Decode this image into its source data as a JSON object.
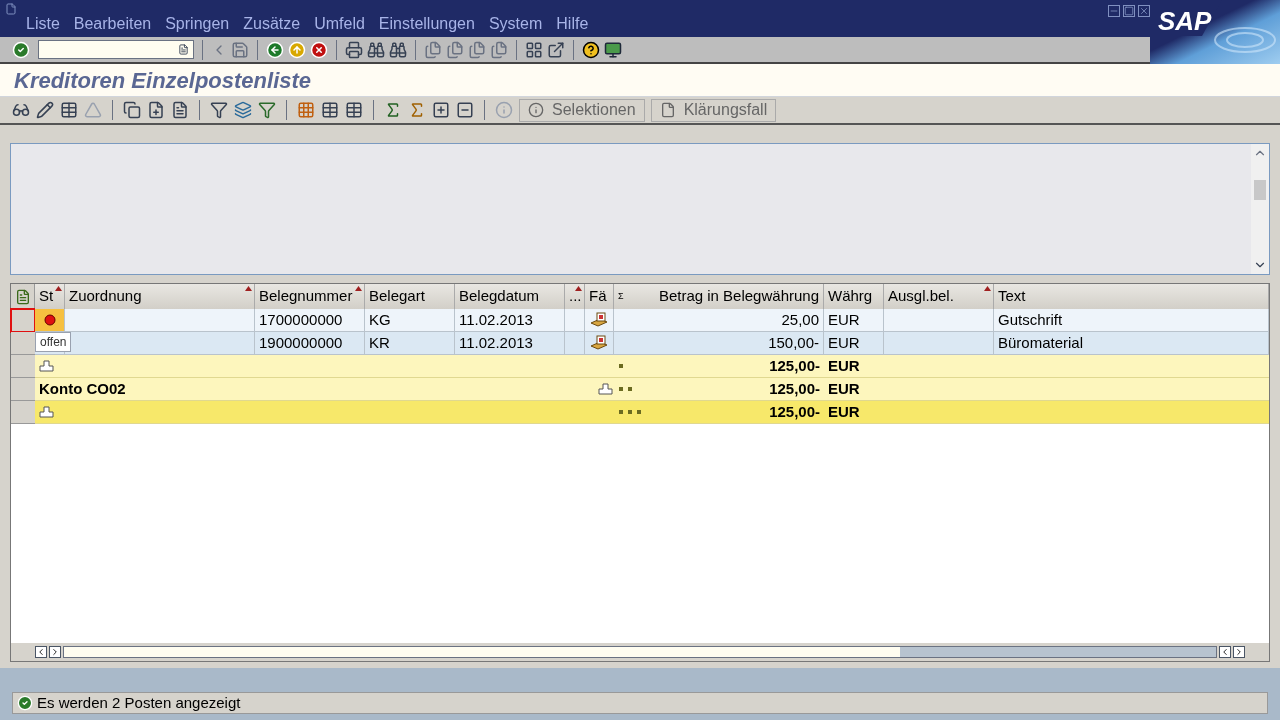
{
  "logo": "SAP",
  "menu": [
    "Liste",
    "Bearbeiten",
    "Springen",
    "Zusätze",
    "Umfeld",
    "Einstellungen",
    "System",
    "Hilfe"
  ],
  "title": "Kreditoren Einzelpostenliste",
  "app_toolbar_buttons": [
    {
      "label": "Selektionen",
      "disabled": true
    },
    {
      "label": "Klärungsfall",
      "disabled": true
    }
  ],
  "table": {
    "columns": [
      {
        "label": "St",
        "sort_mark": true
      },
      {
        "label": "Zuordnung",
        "sort_mark": true
      },
      {
        "label": "Belegnummer",
        "sort_mark": true
      },
      {
        "label": "Belegart",
        "sort_mark": false
      },
      {
        "label": "Belegdatum",
        "sort_mark": false
      },
      {
        "label": "...",
        "sort_mark": true
      },
      {
        "label": "Fä",
        "sort_mark": false
      },
      {
        "label": "Betrag in Belegwährung",
        "sort_mark": false,
        "sum_mark": "Σ"
      },
      {
        "label": "Währg",
        "sort_mark": false
      },
      {
        "label": "Ausgl.bel.",
        "sort_mark": true
      },
      {
        "label": "Text",
        "sort_mark": false
      }
    ],
    "rows": [
      {
        "kind": "item",
        "selected": true,
        "hover": true,
        "belegnummer": "1700000000",
        "belegart": "KG",
        "belegdatum": "11.02.2013",
        "betrag": "25,00",
        "waehrung": "EUR",
        "text": "Gutschrift"
      },
      {
        "kind": "item",
        "selected": false,
        "hover": false,
        "belegnummer": "1900000000",
        "belegart": "KR",
        "belegdatum": "11.02.2013",
        "betrag": "150,00-",
        "waehrung": "EUR",
        "text": "Büromaterial"
      },
      {
        "kind": "subtotal",
        "selected": false,
        "betrag": "125,00-",
        "waehrung": "EUR"
      },
      {
        "kind": "account",
        "selected": false,
        "label": "Konto CO02",
        "betrag": "125,00-",
        "waehrung": "EUR"
      },
      {
        "kind": "total",
        "selected": false,
        "betrag": "125,00-",
        "waehrung": "EUR"
      }
    ]
  },
  "tooltip": "offen",
  "status_bar": {
    "message": "Es werden 2 Posten angezeigt"
  }
}
